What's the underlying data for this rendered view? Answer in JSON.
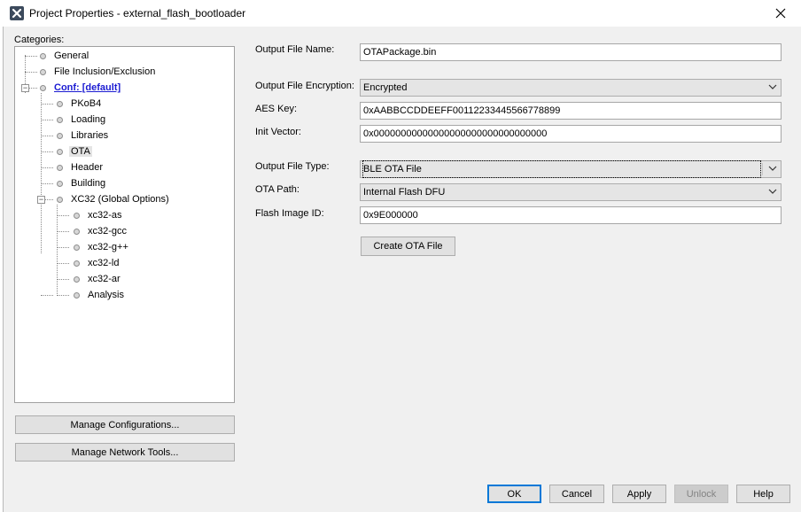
{
  "window": {
    "title": "Project Properties - external_flash_bootloader",
    "app_icon": "netbeans-x-icon",
    "close_icon": "close-icon"
  },
  "categories": {
    "label": "Categories:",
    "items": [
      {
        "label": "General"
      },
      {
        "label": "File Inclusion/Exclusion"
      },
      {
        "label": "Conf: [default]"
      },
      {
        "label": "PKoB4"
      },
      {
        "label": "Loading"
      },
      {
        "label": "Libraries"
      },
      {
        "label": "OTA"
      },
      {
        "label": "Header"
      },
      {
        "label": "Building"
      },
      {
        "label": "XC32 (Global Options)"
      },
      {
        "label": "xc32-as"
      },
      {
        "label": "xc32-gcc"
      },
      {
        "label": "xc32-g++"
      },
      {
        "label": "xc32-ld"
      },
      {
        "label": "xc32-ar"
      },
      {
        "label": "Analysis"
      }
    ],
    "selected": "OTA"
  },
  "left_buttons": {
    "manage_configurations": "Manage Configurations...",
    "manage_network_tools": "Manage Network Tools..."
  },
  "form": {
    "output_file_name": {
      "label": "Output File Name:",
      "value": "OTAPackage.bin"
    },
    "output_file_encryption": {
      "label": "Output File Encryption:",
      "value": "Encrypted"
    },
    "aes_key": {
      "label": "AES Key:",
      "value": "0xAABBCCDDEEFF00112233445566778899"
    },
    "init_vector": {
      "label": "Init Vector:",
      "value": "0x00000000000000000000000000000000"
    },
    "output_file_type": {
      "label": "Output File Type:",
      "value": "BLE OTA File"
    },
    "ota_path": {
      "label": "OTA Path:",
      "value": "Internal Flash DFU"
    },
    "flash_image_id": {
      "label": "Flash Image ID:",
      "value": "0x9E000000"
    },
    "create_button": "Create OTA File"
  },
  "footer": {
    "ok": "OK",
    "cancel": "Cancel",
    "apply": "Apply",
    "unlock": "Unlock",
    "help": "Help"
  },
  "colors": {
    "background": "#f0f0f0",
    "link_blue": "#1b1bd2",
    "focus_blue": "#0078d7"
  }
}
